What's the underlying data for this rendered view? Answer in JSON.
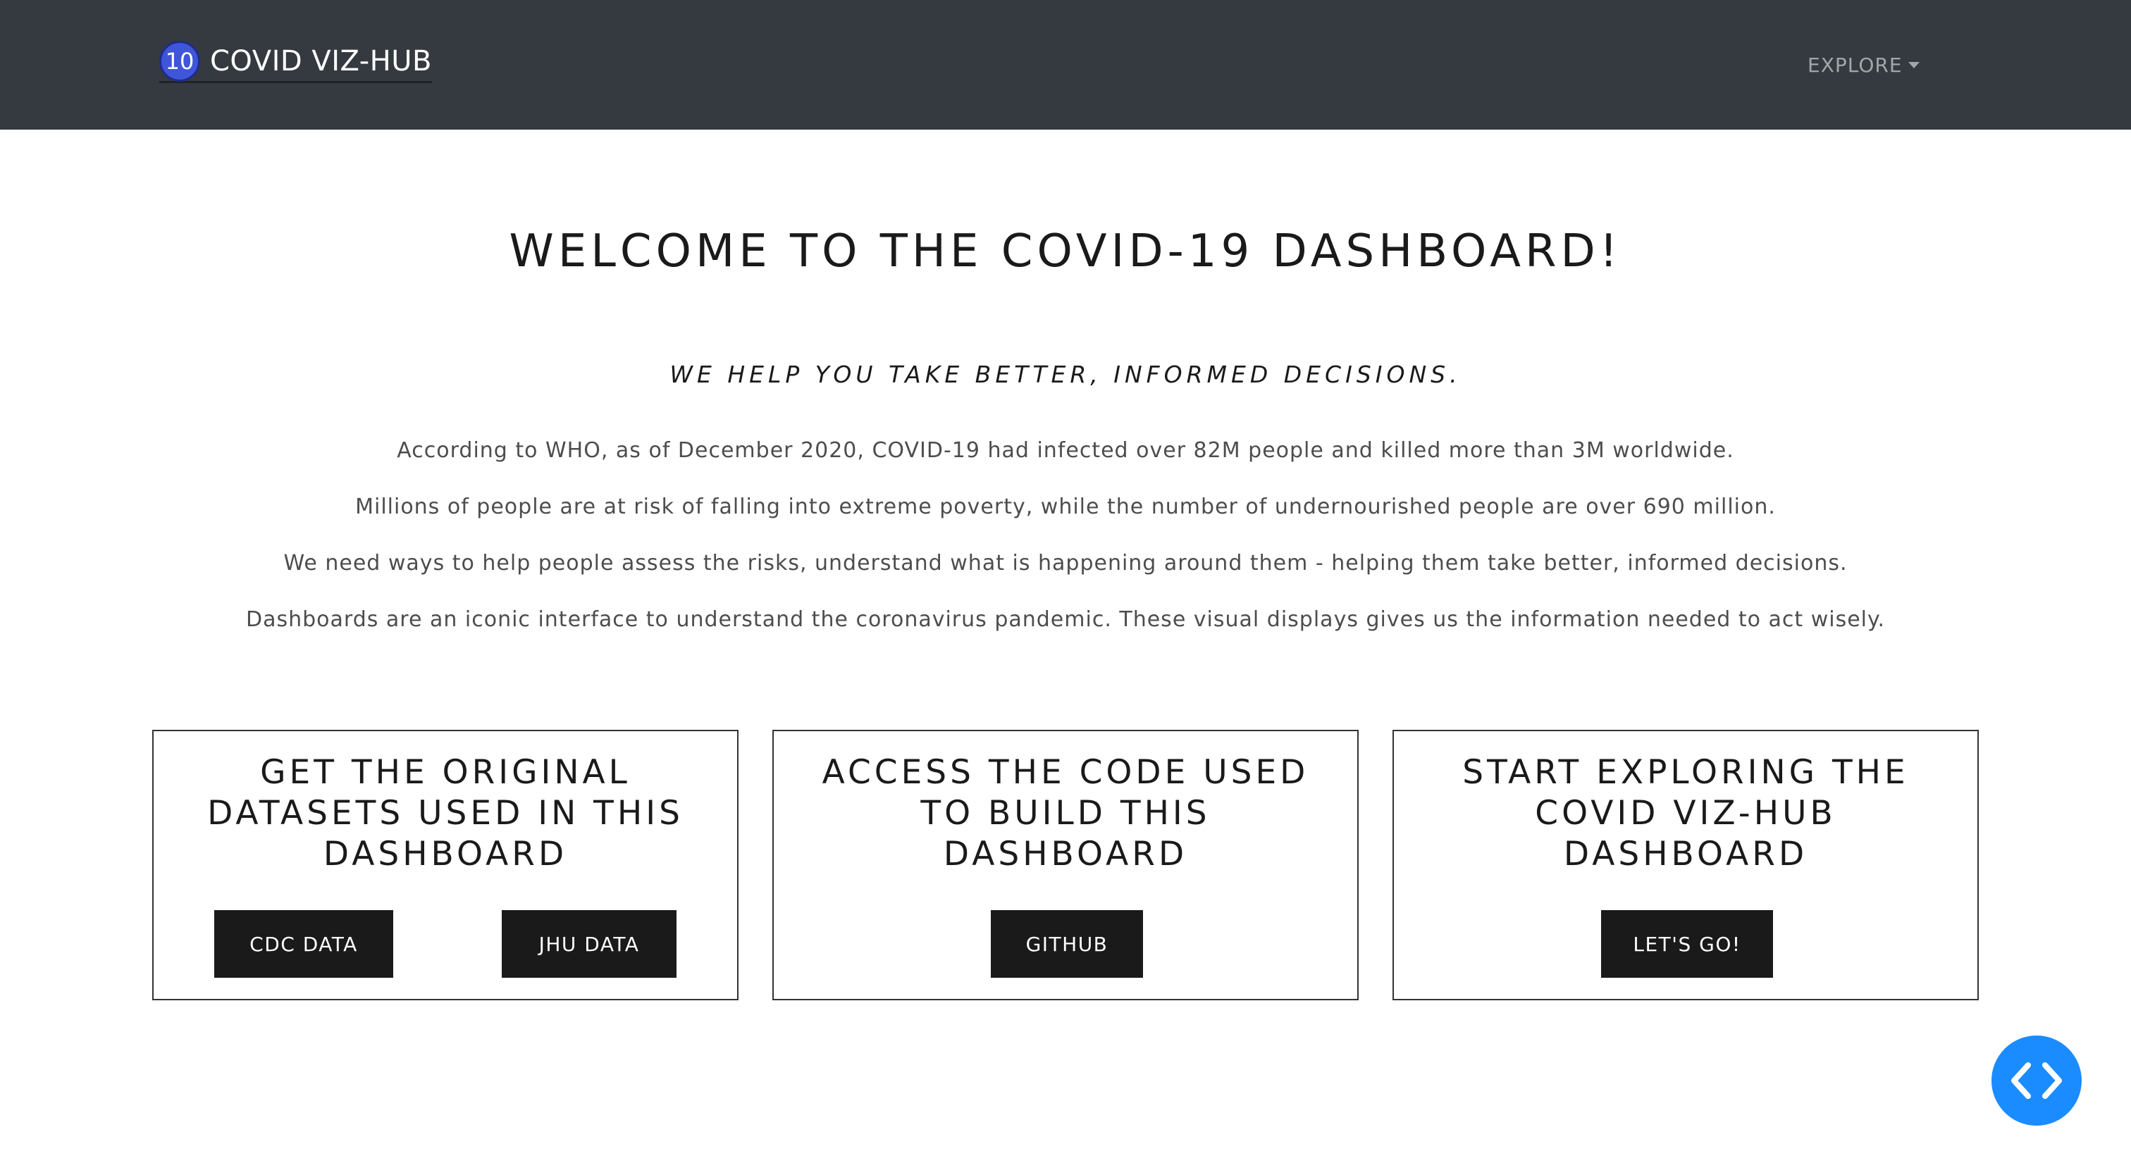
{
  "navbar": {
    "logo_text": "10",
    "brand": "COVID VIZ-HUB",
    "explore_label": "EXPLORE"
  },
  "hero": {
    "title": "WELCOME TO THE COVID-19 DASHBOARD!",
    "tagline": "WE HELP YOU TAKE BETTER, INFORMED DECISIONS.",
    "paragraphs": [
      "According to WHO, as of December 2020, COVID-19 had infected over 82M people and killed more than 3M worldwide.",
      "Millions of people are at risk of falling into extreme poverty, while the number of undernourished people are over 690 million.",
      "We need ways to help people assess the risks, understand what is happening around them - helping them take better, informed decisions.",
      "Dashboards are an iconic interface to understand the coronavirus pandemic. These visual displays gives us the information needed to act wisely."
    ]
  },
  "cards": [
    {
      "title": "GET THE ORIGINAL DATASETS USED IN THIS DASHBOARD",
      "buttons": [
        "CDC DATA",
        "JHU DATA"
      ]
    },
    {
      "title": "ACCESS THE CODE USED TO BUILD THIS DASHBOARD",
      "buttons": [
        "GITHUB"
      ]
    },
    {
      "title": "START EXPLORING THE COVID VIZ-HUB DASHBOARD",
      "buttons": [
        "LET'S GO!"
      ]
    }
  ],
  "fab": {
    "icon": "code-icon",
    "color": "#1a8cff"
  },
  "colors": {
    "navbar_bg": "#343a40",
    "button_bg": "#1a1a1a",
    "logo_bg": "#3f56d8"
  }
}
